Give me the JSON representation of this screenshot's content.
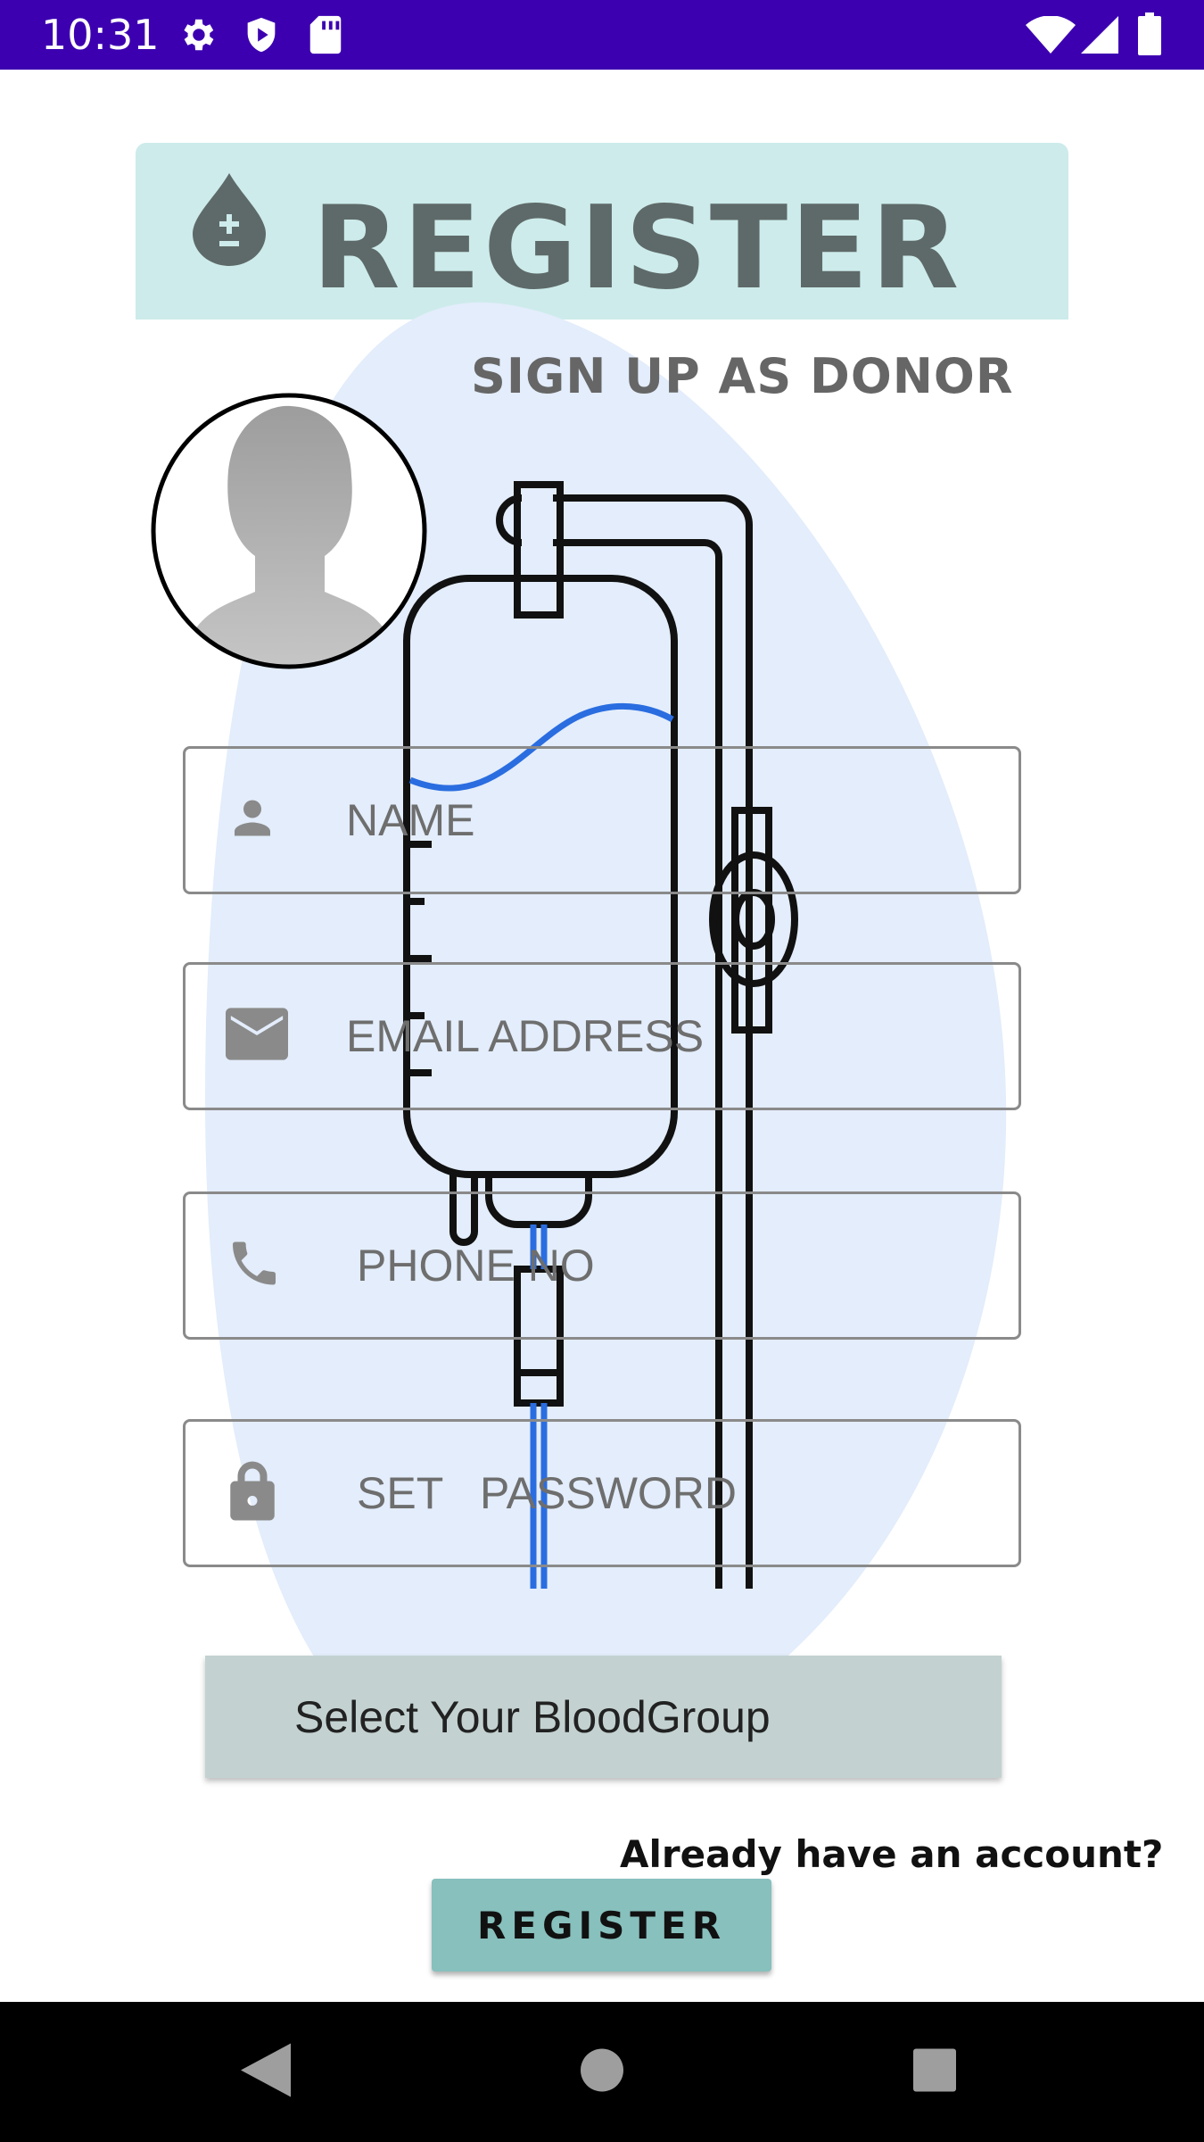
{
  "status_bar": {
    "time": "10:31",
    "icons": [
      "settings-icon",
      "shield-icon",
      "sd-card-icon",
      "wifi-icon",
      "signal-icon",
      "battery-icon"
    ]
  },
  "header": {
    "title": "REGISTER",
    "icon": "blood-drop-icon"
  },
  "subtitle": "SIGN UP AS DONOR",
  "form": {
    "name": {
      "placeholder": "NAME",
      "icon": "person-icon"
    },
    "email": {
      "placeholder": "EMAIL ADDRESS",
      "icon": "email-icon"
    },
    "phone": {
      "placeholder": "PHONE NO",
      "icon": "phone-icon"
    },
    "password": {
      "placeholder": "SET   PASSWORD",
      "icon": "lock-icon"
    }
  },
  "blood_group_select": {
    "label": "Select Your BloodGroup"
  },
  "login_link": "Already have an account?",
  "register_button": "REGISTER",
  "nav_bar": [
    "back-icon",
    "home-icon",
    "recents-icon"
  ],
  "colors": {
    "status_bar": "#3c00b0",
    "header_bg": "#cdebeb",
    "button_bg": "#87c0bd",
    "select_bg": "#c3d2d1",
    "blob": "#e3edfb"
  }
}
